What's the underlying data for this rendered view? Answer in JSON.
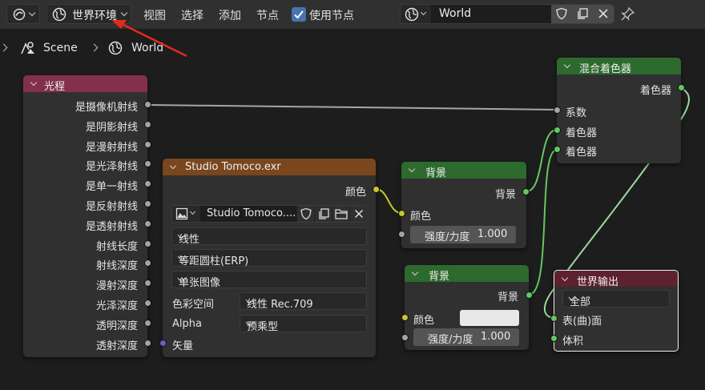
{
  "header": {
    "editor_type_icon": "editor-type-icon",
    "shader_type": "世界环境",
    "menus": [
      "视图",
      "选择",
      "添加",
      "节点"
    ],
    "use_nodes_label": "使用节点",
    "use_nodes_checked": true,
    "world_name": "World"
  },
  "breadcrumb": {
    "scene": "Scene",
    "world": "World"
  },
  "nodes": {
    "light_path": {
      "title": "光程",
      "outputs": [
        "是摄像机射线",
        "是阴影射线",
        "是漫射射线",
        "是光泽射线",
        "是单一射线",
        "是反射射线",
        "是透射射线",
        "射线长度",
        "射线深度",
        "漫射深度",
        "光泽深度",
        "透明深度",
        "透射深度"
      ]
    },
    "env_texture": {
      "title": "Studio Tomoco.exr",
      "output_color": "颜色",
      "image_name": "Studio Tomoco....",
      "interpolation": "线性",
      "projection": "等距圆柱(ERP)",
      "source": "单张图像",
      "color_space_label": "色彩空间",
      "color_space": "线性 Rec.709",
      "alpha_label": "Alpha",
      "alpha": "预乘型",
      "vector_label": "矢量"
    },
    "background1": {
      "title": "背景",
      "output": "背景",
      "color_label": "颜色",
      "strength_label": "强度/力度",
      "strength": "1.000"
    },
    "background2": {
      "title": "背景",
      "output": "背景",
      "color_label": "颜色",
      "strength_label": "强度/力度",
      "strength": "1.000",
      "color": "#e8e8e8"
    },
    "mix_shader": {
      "title": "混合着色器",
      "output": "着色器",
      "factor_label": "系数",
      "shader1": "着色器",
      "shader2": "着色器"
    },
    "world_output": {
      "title": "世界输出",
      "target": "全部",
      "surface": "表(曲)面",
      "volume": "体积"
    }
  },
  "colors": {
    "input_header": "#83314a",
    "texture_header": "#79461d",
    "shader_header": "#2d6a2d",
    "output_header": "#5e2130",
    "annotation_arrow": "#e22a1d"
  }
}
